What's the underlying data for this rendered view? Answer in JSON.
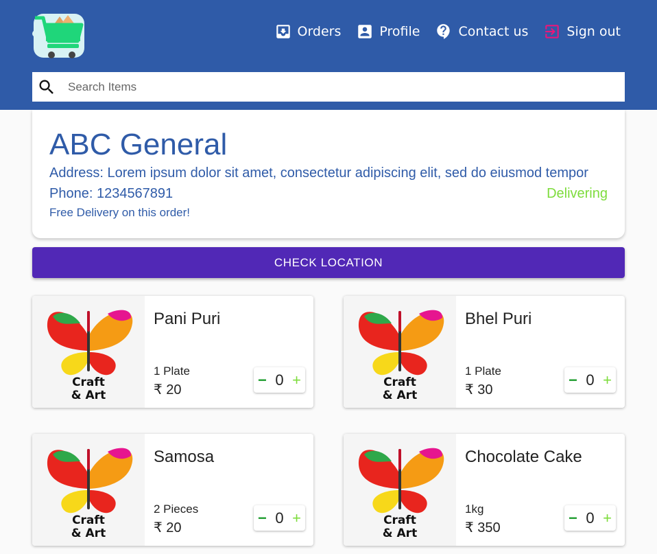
{
  "colors": {
    "header": "#2f5ba8",
    "accent_button": "#5128b6",
    "status_green": "#7ddc3c",
    "signout_icon": "#e8177a"
  },
  "header": {
    "logo_icon": "shopping-cart-logo-icon",
    "nav": [
      {
        "label": "Orders",
        "icon": "inbox-icon"
      },
      {
        "label": "Profile",
        "icon": "account-box-icon"
      },
      {
        "label": "Contact us",
        "icon": "help-bubble-icon"
      },
      {
        "label": "Sign out",
        "icon": "exit-icon"
      }
    ],
    "search": {
      "placeholder": "Search Items",
      "value": ""
    }
  },
  "store": {
    "name": "ABC General",
    "address": "Address: Lorem ipsum dolor sit amet, consectetur adipiscing elit, sed do eiusmod tempor",
    "phone": "Phone: 1234567891",
    "status": "Delivering",
    "delivery_note": "Free Delivery on this order!"
  },
  "check_location_label": "CHECK LOCATION",
  "products": [
    {
      "name": "Pani Puri",
      "unit": "1 Plate",
      "price": "₹ 20",
      "qty": "0",
      "minus": "−",
      "plus": "+",
      "image_text_1": "Craft",
      "image_text_2": "& Art"
    },
    {
      "name": "Bhel Puri",
      "unit": "1 Plate",
      "price": "₹ 30",
      "qty": "0",
      "minus": "−",
      "plus": "+",
      "image_text_1": "Craft",
      "image_text_2": "& Art"
    },
    {
      "name": "Samosa",
      "unit": "2 Pieces",
      "price": "₹ 20",
      "qty": "0",
      "minus": "−",
      "plus": "+",
      "image_text_1": "Craft",
      "image_text_2": "& Art"
    },
    {
      "name": "Chocolate Cake",
      "unit": "1kg",
      "price": "₹ 350",
      "qty": "0",
      "minus": "−",
      "plus": "+",
      "image_text_1": "Craft",
      "image_text_2": "& Art"
    }
  ]
}
